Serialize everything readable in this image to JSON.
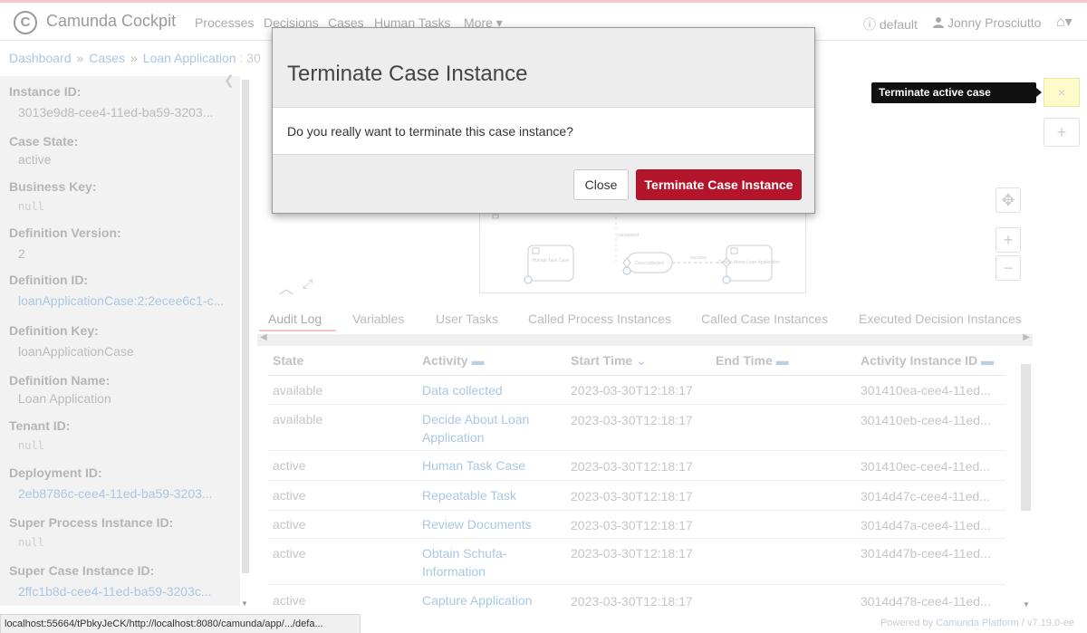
{
  "app": {
    "logo_glyph": "C",
    "name": "Camunda Cockpit"
  },
  "nav": {
    "processes": "Processes",
    "decisions": "Decisions",
    "cases": "Cases",
    "human_tasks": "Human Tasks",
    "more": "More ▾",
    "engine": "default",
    "user": "Jonny Prosciutto",
    "home_glyph": "⌂▾"
  },
  "breadcrumb": {
    "dashboard": "Dashboard",
    "cases": "Cases",
    "loan_application": "Loan Application",
    "current": "30"
  },
  "sidebar": {
    "items": [
      {
        "label": "Instance ID:",
        "value": "3013e9d8-cee4-11ed-ba59-3203..."
      },
      {
        "label": "Case State:",
        "value": "active"
      },
      {
        "label": "Business Key:",
        "value": "null"
      },
      {
        "label": "Definition Version:",
        "value": "2"
      },
      {
        "label": "Definition ID:",
        "value": "loanApplicationCase:2:2ecee6c1-c..."
      },
      {
        "label": "Definition Key:",
        "value": "loanApplicationCase"
      },
      {
        "label": "Definition Name:",
        "value": "Loan Application"
      },
      {
        "label": "Tenant ID:",
        "value": "null"
      },
      {
        "label": "Deployment ID:",
        "value": "2eb8786c-cee4-11ed-ba59-3203..."
      },
      {
        "label": "Super Process Instance ID:",
        "value": "null"
      },
      {
        "label": "Super Case Instance ID:",
        "value": "2ffc1b8d-cee4-11ed-ba59-3203c..."
      }
    ]
  },
  "diagram": {
    "label_human_task": "Human Task Case",
    "label_data_collected": "Data collected",
    "label_decide": "Decide About Loan Application",
    "label_completed": "completed",
    "label_success": "success"
  },
  "actions": {
    "terminate_icon": "×",
    "terminate_tooltip": "Terminate active case instance",
    "add_icon": "+"
  },
  "tabs": {
    "audit_log": "Audit Log",
    "variables": "Variables",
    "user_tasks": "User Tasks",
    "called_process": "Called Process Instances",
    "called_case": "Called Case Instances",
    "executed_decision": "Executed Decision Instances"
  },
  "table": {
    "headers": {
      "state": "State",
      "activity": "Activity",
      "start_time": "Start Time",
      "end_time": "End Time",
      "activity_instance_id": "Activity Instance ID"
    },
    "rows": [
      {
        "state": "available",
        "activity": "Data collected",
        "start": "2023-03-30T12:18:17",
        "end": "",
        "id": "301410ea-cee4-11ed..."
      },
      {
        "state": "available",
        "activity": "Decide About Loan Application",
        "start": "2023-03-30T12:18:17",
        "end": "",
        "id": "301410eb-cee4-11ed..."
      },
      {
        "state": "active",
        "activity": "Human Task Case",
        "start": "2023-03-30T12:18:17",
        "end": "",
        "id": "301410ec-cee4-11ed..."
      },
      {
        "state": "active",
        "activity": "Repeatable Task",
        "start": "2023-03-30T12:18:17",
        "end": "",
        "id": "3014d47c-cee4-11ed..."
      },
      {
        "state": "active",
        "activity": "Review Documents",
        "start": "2023-03-30T12:18:17",
        "end": "",
        "id": "3014d47a-cee4-11ed..."
      },
      {
        "state": "active",
        "activity": "Obtain Schufa-Information",
        "start": "2023-03-30T12:18:17",
        "end": "",
        "id": "3014d47b-cee4-11ed..."
      },
      {
        "state": "active",
        "activity": "Capture Application",
        "start": "2023-03-30T12:18:17",
        "end": "",
        "id": "3014d478-cee4-11ed..."
      }
    ]
  },
  "modal": {
    "title": "Terminate Case Instance",
    "body": "Do you really want to terminate this case instance?",
    "close_label": "Close",
    "confirm_label": "Terminate Case Instance"
  },
  "statusbar": {
    "url": "localhost:55664/tPbkyJeCK/http://localhost:8080/camunda/app/.../defa..."
  },
  "footer": {
    "prefix": "Powered by",
    "link": "Camunda Platform",
    "version": "/ v7.19.0-ee"
  },
  "colors": {
    "danger": "#b5152b",
    "tooltip_bg": "#111111",
    "highlight": "#fdfbc9"
  }
}
